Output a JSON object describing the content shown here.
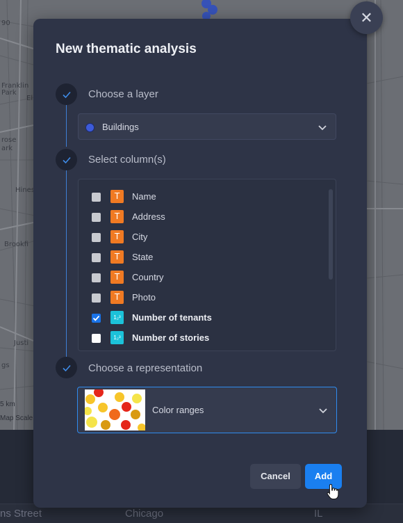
{
  "map": {
    "labels": [
      "90",
      "Franklin",
      "Park",
      "El",
      "rose",
      "ark",
      "Hines",
      "Brookfi",
      "Justi",
      "gs",
      "5 km"
    ],
    "scale_label": "Map Scale"
  },
  "table_row": {
    "cells": [
      "ns Street",
      "Chicago",
      "IL"
    ]
  },
  "modal": {
    "title": "New thematic analysis",
    "close_icon": "close-icon",
    "steps": [
      {
        "label": "Choose a layer"
      },
      {
        "label": "Select column(s)"
      },
      {
        "label": "Choose a representation"
      }
    ],
    "layer_select": {
      "value": "Buildings",
      "dot_color": "#3d5bd9"
    },
    "columns": [
      {
        "name": "Name",
        "type": "T",
        "checked": false
      },
      {
        "name": "Address",
        "type": "T",
        "checked": false
      },
      {
        "name": "City",
        "type": "T",
        "checked": false
      },
      {
        "name": "State",
        "type": "T",
        "checked": false
      },
      {
        "name": "Country",
        "type": "T",
        "checked": false
      },
      {
        "name": "Photo",
        "type": "T",
        "checked": false
      },
      {
        "name": "Number of tenants",
        "type": "123",
        "checked": true
      },
      {
        "name": "Number of stories",
        "type": "123",
        "checked": false
      }
    ],
    "representation_select": {
      "value": "Color ranges"
    },
    "buttons": {
      "cancel": "Cancel",
      "add": "Add"
    },
    "colors": {
      "accent": "#1a7ff0",
      "text_type": "#f07a23",
      "numeric_type": "#1cc2d9"
    }
  }
}
